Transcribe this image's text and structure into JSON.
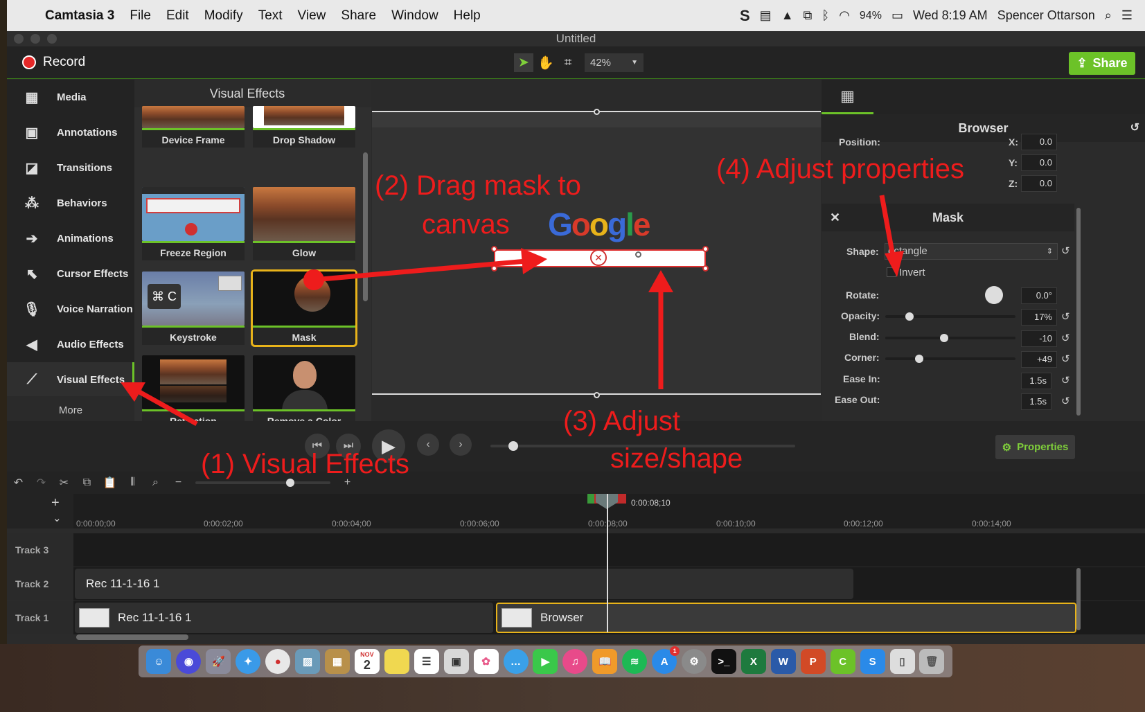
{
  "menubar": {
    "app": "Camtasia 3",
    "items": [
      "File",
      "Edit",
      "Modify",
      "Text",
      "View",
      "Share",
      "Window",
      "Help"
    ],
    "battery": "94%",
    "clock": "Wed 8:19 AM",
    "user": "Spencer Ottarson"
  },
  "window": {
    "title": "Untitled",
    "record_label": "Record",
    "zoom": "42%",
    "share_label": "Share"
  },
  "sidebar": {
    "items": [
      {
        "label": "Media",
        "icon": "film-icon"
      },
      {
        "label": "Annotations",
        "icon": "annotation-icon"
      },
      {
        "label": "Transitions",
        "icon": "transition-icon"
      },
      {
        "label": "Behaviors",
        "icon": "behavior-icon"
      },
      {
        "label": "Animations",
        "icon": "arrow-icon"
      },
      {
        "label": "Cursor Effects",
        "icon": "cursor-icon"
      },
      {
        "label": "Voice Narration",
        "icon": "microphone-icon"
      },
      {
        "label": "Audio Effects",
        "icon": "speaker-icon"
      },
      {
        "label": "Visual Effects",
        "icon": "magic-wand-icon"
      }
    ],
    "more": "More"
  },
  "library": {
    "title": "Visual Effects",
    "tiles": [
      "Device Frame",
      "Drop Shadow",
      "Freeze Region",
      "Glow",
      "Keystroke",
      "Mask",
      "Reflection",
      "Remove a Color"
    ],
    "keystroke_text": "⌘ C",
    "selected": "Mask"
  },
  "canvas": {
    "logo": [
      "G",
      "o",
      "o",
      "g",
      "l",
      "e"
    ],
    "logo_colors": [
      "#3a6ad8",
      "#d83a2a",
      "#e8b31a",
      "#3a6ad8",
      "#2a9a4a",
      "#d83a2a"
    ]
  },
  "properties": {
    "browser_title": "Browser",
    "position_label": "Position:",
    "x": "0.0",
    "y": "0.0",
    "z": "0.0",
    "mask_title": "Mask",
    "shape_label": "Shape:",
    "shape_value": "ectangle",
    "invert_label": "Invert",
    "rotate_label": "Rotate:",
    "rotate": "0.0°",
    "opacity_label": "Opacity:",
    "opacity": "17%",
    "opacity_level": 0.17,
    "blend_label": "Blend:",
    "blend": "-10",
    "corner_label": "Corner:",
    "corner": "+49",
    "easein_label": "Ease In:",
    "easein": "1.5s",
    "easeout_label": "Ease Out:",
    "easeout": "1.5s",
    "properties_button": "Properties"
  },
  "timeline": {
    "playhead_time": "0:00:08;10",
    "ticks": [
      "0:00:00;00",
      "0:00:02;00",
      "0:00:04;00",
      "0:00:06;00",
      "0:00:08;00",
      "0:00:10;00",
      "0:00:12;00",
      "0:00:14;00"
    ],
    "tracks": [
      "Track 3",
      "Track 2",
      "Track 1"
    ],
    "clips": {
      "track2": "Rec 11-1-16 1",
      "track1a": "Rec 11-1-16 1",
      "track1b": "Browser"
    }
  },
  "dock": {
    "calendar_month": "NOV",
    "calendar_day": "2",
    "appstore_badge": "1"
  },
  "annotations": {
    "step1": "(1) Visual Effects",
    "step2a": "(2) Drag mask to",
    "step2b": "canvas",
    "step3a": "(3) Adjust",
    "step3b": "size/shape",
    "step4": "(4) Adjust properties"
  },
  "colors": {
    "accent": "#6cc228",
    "annotation": "#ee1c1c",
    "selection": "#e8b31a"
  }
}
